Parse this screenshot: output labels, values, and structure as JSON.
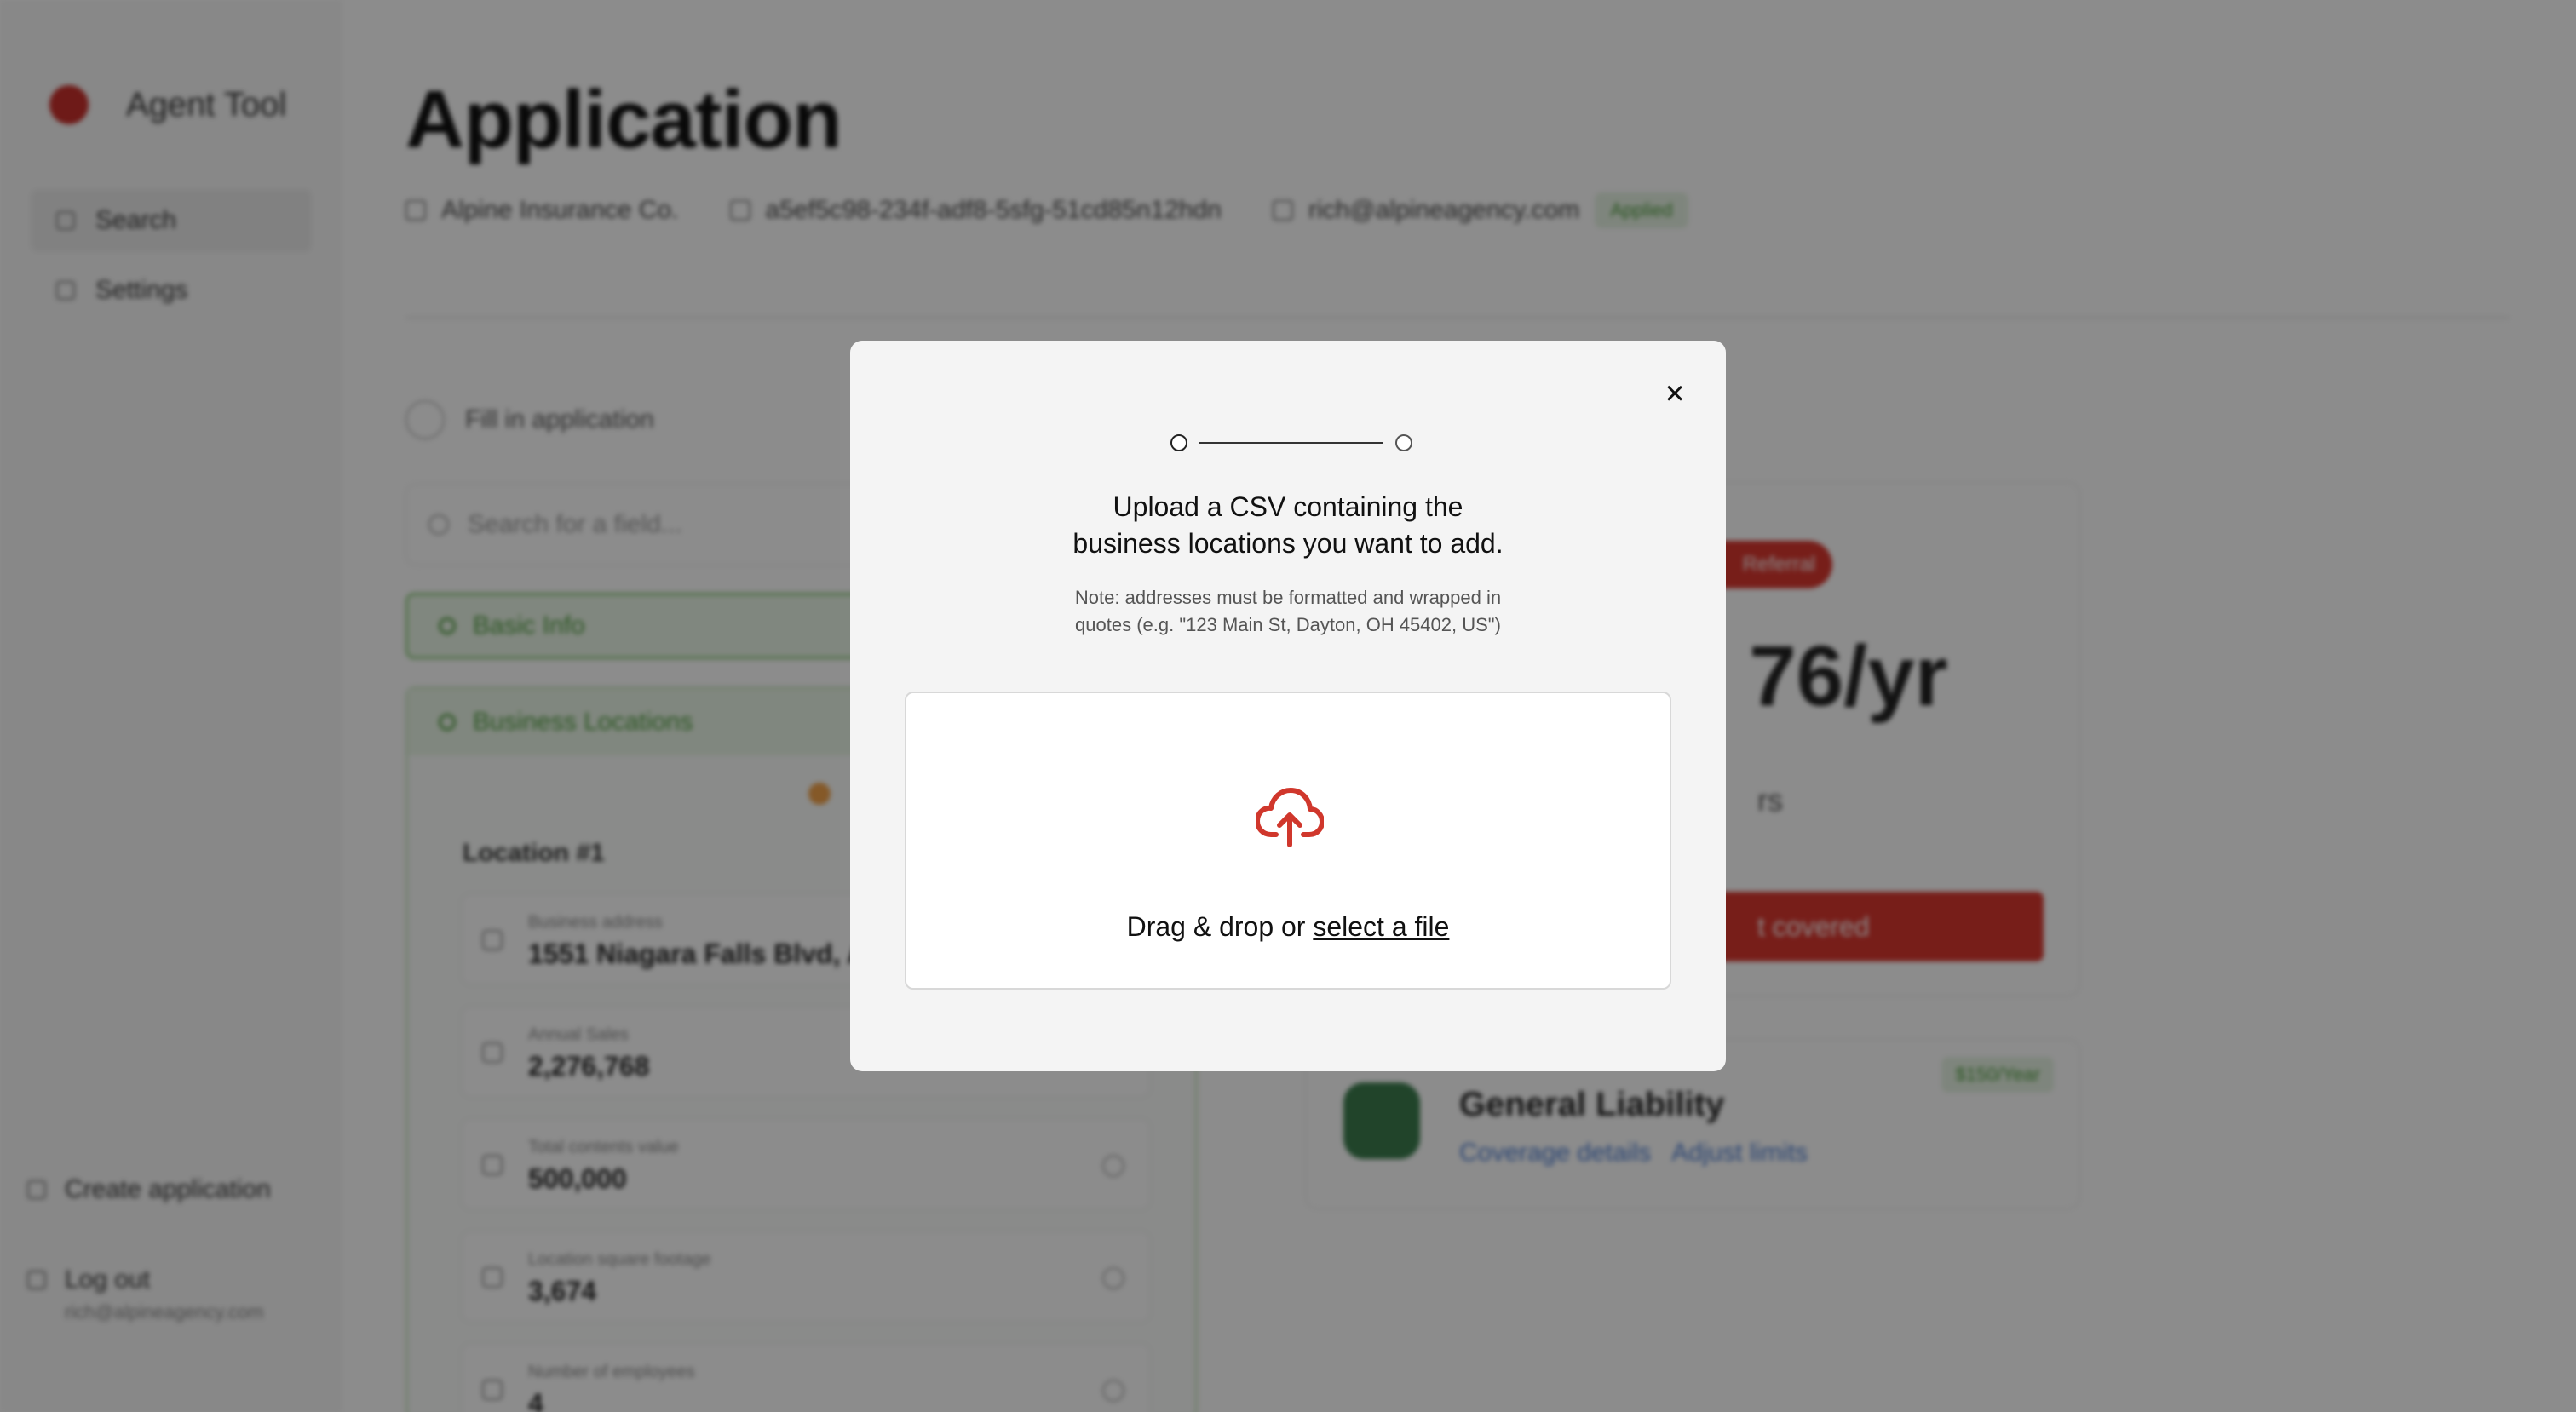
{
  "sidebar": {
    "brand_name": "Agent Tool",
    "nav": [
      {
        "label": "Search"
      },
      {
        "label": "Settings"
      }
    ],
    "create_label": "Create application",
    "logout_label": "Log out",
    "logout_email": "rich@alpineagency.com"
  },
  "header": {
    "title": "Application",
    "agency": "Alpine Insurance Co.",
    "application_id": "a5ef5c98-234f-adf8-5sfg-51cd85n12hdn",
    "email": "rich@alpineagency.com",
    "status_badge": "Applied"
  },
  "form": {
    "fill_label": "Fill in application",
    "search_placeholder": "Search for a field...",
    "basic_info_label": "Basic Info",
    "business_locations_label": "Business Locations",
    "location_title": "Location #1",
    "fields": [
      {
        "label": "Business address",
        "value": "1551 Niagara Falls Blvd, Am"
      },
      {
        "label": "Annual Sales",
        "value": "2,276,768"
      },
      {
        "label": "Total contents value",
        "value": "500,000"
      },
      {
        "label": "Location square footage",
        "value": "3,674"
      },
      {
        "label": "Number of employees",
        "value": "4"
      }
    ]
  },
  "quote": {
    "badge": "Referral",
    "price": "76/yr",
    "sub": "rs",
    "button": "t covered"
  },
  "gl_card": {
    "title": "General Liability",
    "link_details": "Coverage details",
    "link_limits": "Adjust limits",
    "badge": "$150/Year"
  },
  "modal": {
    "heading_line1": "Upload a CSV containing the",
    "heading_line2": "business locations you want to add.",
    "note_line1": "Note: addresses must be formatted and wrapped in",
    "note_line2": "quotes (e.g. \"123 Main St, Dayton, OH 45402, US\")",
    "drop_text": "Drag & drop or ",
    "select_link": "select a file",
    "close_symbol": "×",
    "steps_total": 2,
    "current_step": 1,
    "upload_icon": "cloud-upload-icon",
    "accent_color": "#d0372c"
  }
}
